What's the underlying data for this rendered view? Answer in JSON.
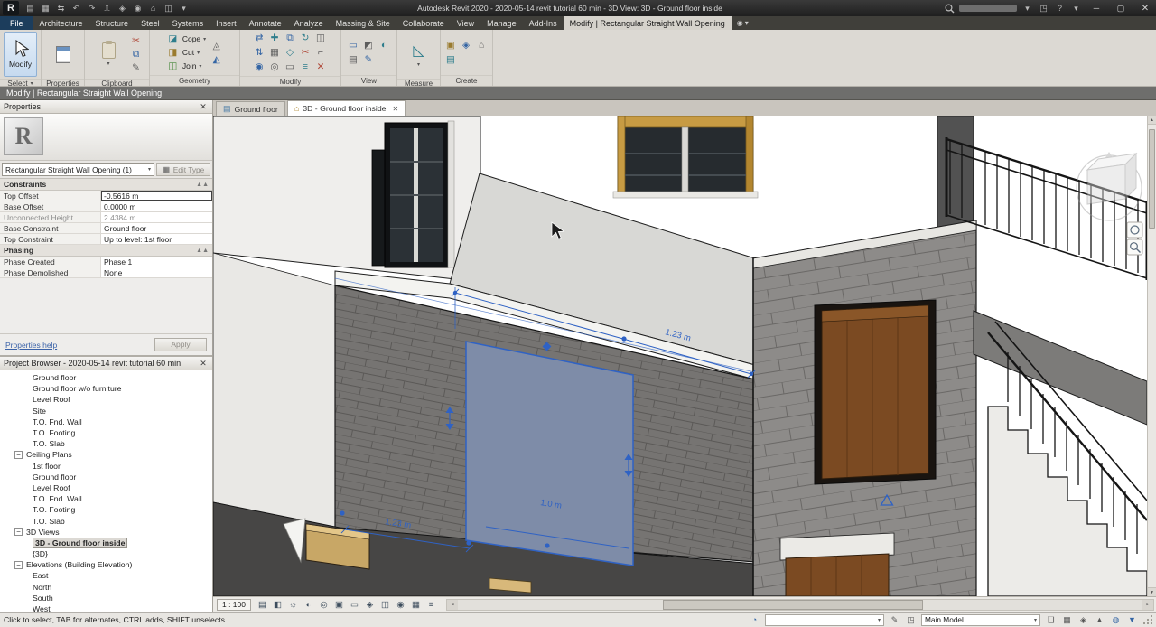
{
  "title_bar": {
    "title": "Autodesk Revit 2020 - 2020-05-14 revit tutorial 60 min - 3D View: 3D - Ground floor inside"
  },
  "ribbon_tabs": {
    "file": "File",
    "items": [
      "Architecture",
      "Structure",
      "Steel",
      "Systems",
      "Insert",
      "Annotate",
      "Analyze",
      "Massing & Site",
      "Collaborate",
      "View",
      "Manage",
      "Add-Ins"
    ],
    "active": "Modify | Rectangular Straight Wall Opening"
  },
  "ribbon": {
    "modify_button": "Modify",
    "geometry": {
      "cope": "Cope",
      "cut": "Cut",
      "join": "Join"
    },
    "panel_labels": {
      "select": "Select",
      "properties": "Properties",
      "clipboard": "Clipboard",
      "geometry": "Geometry",
      "modify": "Modify",
      "view": "View",
      "measure": "Measure",
      "create": "Create"
    }
  },
  "mode_bar": {
    "text": "Modify | Rectangular Straight Wall Opening"
  },
  "properties": {
    "header": "Properties",
    "type_name": "Rectangular Straight Wall Opening (1)",
    "edit_type": "Edit Type",
    "section_constraints": "Constraints",
    "section_phasing": "Phasing",
    "rows": [
      {
        "label": "Top Offset",
        "value": "-0.5616 m"
      },
      {
        "label": "Base Offset",
        "value": "0.0000 m"
      },
      {
        "label": "Unconnected Height",
        "value": "2.4384 m"
      },
      {
        "label": "Base Constraint",
        "value": "Ground floor"
      },
      {
        "label": "Top Constraint",
        "value": "Up to level: 1st floor"
      }
    ],
    "phasing_rows": [
      {
        "label": "Phase Created",
        "value": "Phase 1"
      },
      {
        "label": "Phase Demolished",
        "value": "None"
      }
    ],
    "help_link": "Properties help",
    "apply": "Apply"
  },
  "browser": {
    "title": "Project Browser - 2020-05-14 revit tutorial 60 min",
    "items": [
      "Ground floor",
      "Ground floor w/o furniture",
      "Level Roof",
      "Site",
      "T.O. Fnd. Wall",
      "T.O. Footing",
      "T.O. Slab",
      "Ceiling Plans",
      "1st floor",
      "Ground floor",
      "Level Roof",
      "T.O. Fnd. Wall",
      "T.O. Footing",
      "T.O. Slab",
      "3D Views",
      "3D - Ground floor inside",
      "{3D}",
      "Elevations (Building Elevation)",
      "East",
      "North",
      "South",
      "West"
    ]
  },
  "view_tabs": {
    "tab_plan": "Ground floor",
    "tab_3d": "3D - Ground floor inside"
  },
  "viewport": {
    "scale": "1 : 100",
    "dim_wall": "1.23 m",
    "dim_floor": "1.23 m",
    "dim_opening": "1.0 m"
  },
  "status_bar": {
    "message": "Click to select, TAB for alternates, CTRL adds, SHIFT unselects.",
    "main_model": "Main Model"
  },
  "colors": {
    "accent_blue": "#2f62c4",
    "selection_fill": "#7e8ca8"
  }
}
